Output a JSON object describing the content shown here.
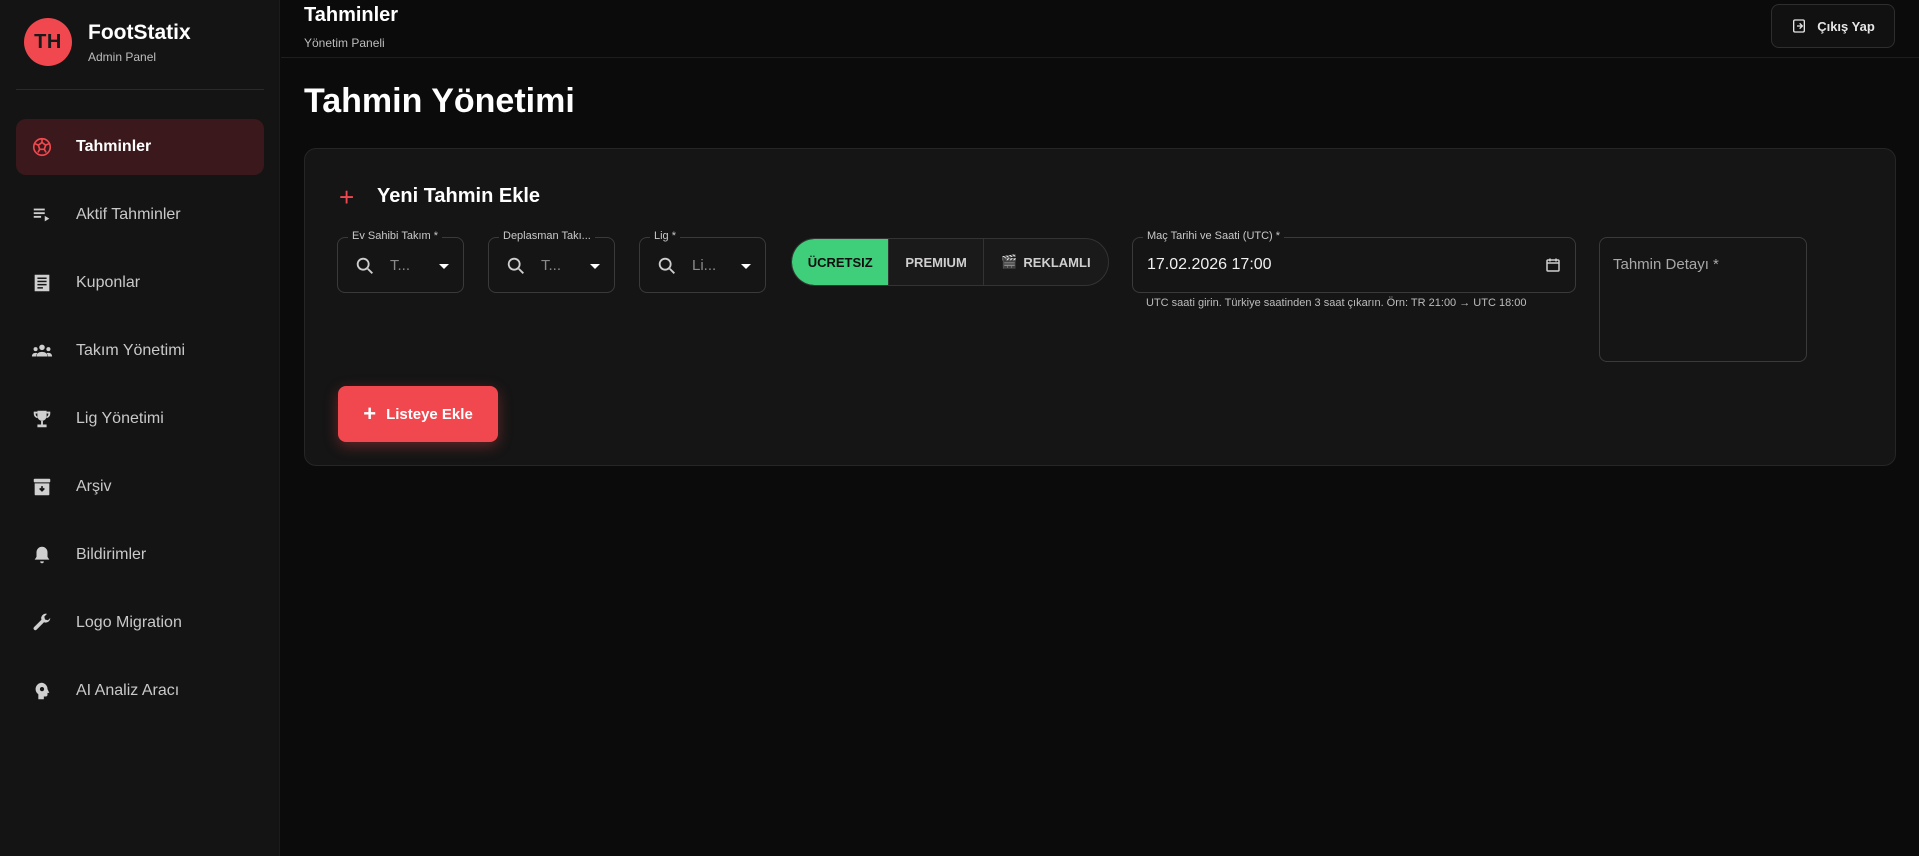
{
  "sidebar": {
    "avatar_initials": "TH",
    "brand_title": "FootStatix",
    "brand_subtitle": "Admin Panel",
    "items": [
      {
        "label": "Tahminler",
        "icon": "soccer-ball-icon",
        "active": true
      },
      {
        "label": "Aktif Tahminler",
        "icon": "playlist-play-icon",
        "active": false
      },
      {
        "label": "Kuponlar",
        "icon": "receipt-icon",
        "active": false
      },
      {
        "label": "Takım Yönetimi",
        "icon": "groups-icon",
        "active": false
      },
      {
        "label": "Lig Yönetimi",
        "icon": "trophy-icon",
        "active": false
      },
      {
        "label": "Arşiv",
        "icon": "archive-icon",
        "active": false
      },
      {
        "label": "Bildirimler",
        "icon": "bell-icon",
        "active": false
      },
      {
        "label": "Logo Migration",
        "icon": "wrench-icon",
        "active": false
      },
      {
        "label": "AI Analiz Aracı",
        "icon": "brain-icon",
        "active": false
      }
    ]
  },
  "header": {
    "title": "Tahminler",
    "subtitle": "Yönetim Paneli",
    "logout_label": "Çıkış Yap"
  },
  "main": {
    "page_title": "Tahmin Yönetimi",
    "card_title": "Yeni Tahmin Ekle",
    "home_team": {
      "label": "Ev Sahibi Takım *",
      "value": "T..."
    },
    "away_team": {
      "label": "Deplasman Takı...",
      "value": "T..."
    },
    "league": {
      "label": "Lig *",
      "value": "Li..."
    },
    "type_toggle": {
      "options": [
        "ÜCRETSIZ",
        "PREMIUM",
        "REKLAMLI"
      ],
      "selected": "ÜCRETSIZ"
    },
    "datetime": {
      "label": "Maç Tarihi ve Saati (UTC) *",
      "value": "17.02.2026 17:00",
      "helper": "UTC saati girin. Türkiye saatinden 3 saat çıkarın. Örn: TR 21:00 → UTC 18:00"
    },
    "detail_placeholder": "Tahmin Detayı *",
    "add_button": "Listeye Ekle"
  },
  "colors": {
    "accent": "#f0484e",
    "success": "#3fcf7a",
    "background": "#0b0b0b",
    "sidebar": "#141414",
    "card": "#151515"
  }
}
